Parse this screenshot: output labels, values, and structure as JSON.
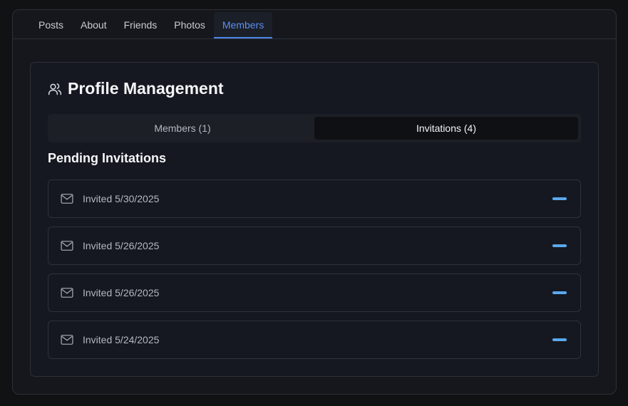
{
  "nav": {
    "tabs": [
      {
        "label": "Posts"
      },
      {
        "label": "About"
      },
      {
        "label": "Friends"
      },
      {
        "label": "Photos"
      },
      {
        "label": "Members",
        "active": true
      }
    ]
  },
  "card": {
    "title": "Profile Management",
    "title_icon": "users-icon",
    "subtabs": [
      {
        "label": "Members (1)"
      },
      {
        "label": "Invitations (4)",
        "active": true
      }
    ],
    "section_heading": "Pending Invitations",
    "invitations": [
      {
        "text": "Invited 5/30/2025"
      },
      {
        "text": "Invited 5/26/2025"
      },
      {
        "text": "Invited 5/26/2025"
      },
      {
        "text": "Invited 5/24/2025"
      }
    ]
  },
  "colors": {
    "accent": "#4e86ec",
    "action": "#5aa8ee",
    "background": "#111214"
  }
}
